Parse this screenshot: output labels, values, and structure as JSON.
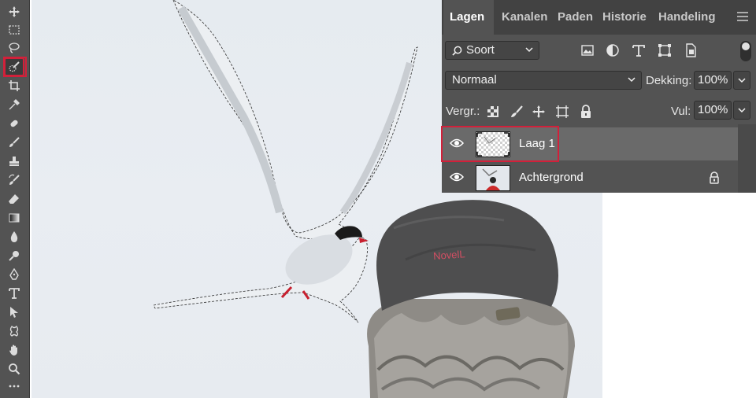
{
  "toolbar": {
    "tools": [
      {
        "name": "move-tool-icon"
      },
      {
        "name": "rectangular-marquee-icon"
      },
      {
        "name": "lasso-icon"
      },
      {
        "name": "quick-selection-icon",
        "active": true
      },
      {
        "name": "crop-icon"
      },
      {
        "name": "eyedropper-icon"
      },
      {
        "name": "healing-brush-icon"
      },
      {
        "name": "brush-icon"
      },
      {
        "name": "clone-stamp-icon"
      },
      {
        "name": "history-brush-icon"
      },
      {
        "name": "eraser-icon"
      },
      {
        "name": "gradient-icon"
      },
      {
        "name": "blur-icon"
      },
      {
        "name": "dodge-icon"
      },
      {
        "name": "pen-icon"
      },
      {
        "name": "type-icon"
      },
      {
        "name": "path-selection-icon"
      },
      {
        "name": "custom-shape-icon"
      },
      {
        "name": "hand-icon"
      },
      {
        "name": "zoom-icon"
      },
      {
        "name": "more-tools-icon"
      }
    ]
  },
  "canvas": {
    "cap_text": "NovelL"
  },
  "layers_panel": {
    "tabs": [
      {
        "label": "Lagen",
        "active": true
      },
      {
        "label": "Kanalen"
      },
      {
        "label": "Paden"
      },
      {
        "label": "Historie"
      },
      {
        "label": "Handeling"
      }
    ],
    "filter_label": "Soort",
    "filter_icons": [
      "image-filter-icon",
      "adjustment-filter-icon",
      "type-filter-icon",
      "shape-filter-icon",
      "smart-object-filter-icon"
    ],
    "blend_mode": "Normaal",
    "opacity_label": "Dekking:",
    "opacity_value": "100%",
    "lock_label": "Vergr.:",
    "fill_label": "Vul:",
    "fill_value": "100%",
    "layers": [
      {
        "name": "Laag 1",
        "selected": true,
        "visible": true
      },
      {
        "name": "Achtergrond",
        "selected": false,
        "visible": true,
        "locked": true
      }
    ]
  },
  "colors": {
    "highlight": "#d2203a",
    "panel_bg": "#535353",
    "tab_bg": "#424242"
  }
}
